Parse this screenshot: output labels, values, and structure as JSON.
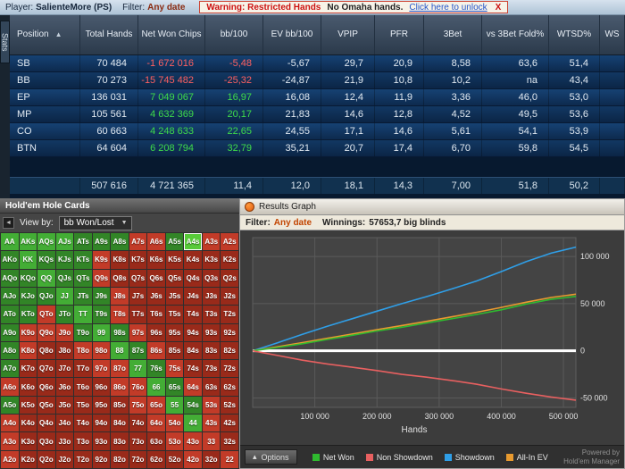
{
  "icons": {
    "sort_up": "▲",
    "chevron_down": "▼",
    "collapse_left": "◄",
    "options_up": "▴"
  },
  "topbar": {
    "player_label": "Player:",
    "player_name": "SalienteMore (PS)",
    "filter_label": "Filter:",
    "filter_value": "Any date",
    "warning": {
      "title": "Warning: Restricted Hands",
      "text": "No Omaha hands.",
      "link": "Click here to unlock",
      "close": "X"
    }
  },
  "stats_tab": "Stats",
  "table": {
    "sort_indicator": "▲",
    "columns": [
      "Position",
      "Total Hands",
      "Net Won Chips",
      "bb/100",
      "EV bb/100",
      "VPIP",
      "PFR",
      "3Bet",
      "vs 3Bet Fold%",
      "WTSD%",
      "WS"
    ],
    "rows": [
      [
        "SB",
        "70 484",
        "-1 672 016",
        "-5,48",
        "-5,67",
        "29,7",
        "20,9",
        "8,58",
        "63,6",
        "51,4",
        ""
      ],
      [
        "BB",
        "70 273",
        "-15 745 482",
        "-25,32",
        "-24,87",
        "21,9",
        "10,8",
        "10,2",
        "na",
        "43,4",
        ""
      ],
      [
        "EP",
        "136 031",
        "7 049 067",
        "16,97",
        "16,08",
        "12,4",
        "11,9",
        "3,36",
        "46,0",
        "53,0",
        ""
      ],
      [
        "MP",
        "105 561",
        "4 632 369",
        "20,17",
        "21,83",
        "14,6",
        "12,8",
        "4,52",
        "49,5",
        "53,6",
        ""
      ],
      [
        "CO",
        "60 663",
        "4 248 633",
        "22,65",
        "24,55",
        "17,1",
        "14,6",
        "5,61",
        "54,1",
        "53,9",
        ""
      ],
      [
        "BTN",
        "64 604",
        "6 208 794",
        "32,79",
        "35,21",
        "20,7",
        "17,4",
        "6,70",
        "59,8",
        "54,5",
        ""
      ]
    ],
    "summary": [
      "",
      "507 616",
      "4 721 365",
      "11,4",
      "12,0",
      "18,1",
      "14,3",
      "7,00",
      "51,8",
      "50,2",
      ""
    ]
  },
  "holecards": {
    "title": "Hold'em Hole Cards",
    "viewby_label": "View by:",
    "viewby_value": "bb Won/Lost",
    "grid": [
      [
        "AA|G",
        "AKs|G",
        "AQs|G",
        "AJs|G",
        "ATs|g",
        "A9s|g",
        "A8s|g",
        "A7s|R",
        "A6s|R",
        "A5s|g",
        "A4s|S",
        "A3s|R",
        "A2s|R"
      ],
      [
        "AKo|g",
        "KK|G",
        "KQs|g",
        "KJs|g",
        "KTs|g",
        "K9s|R",
        "K8s|r",
        "K7s|r",
        "K6s|r",
        "K5s|r",
        "K4s|r",
        "K3s|r",
        "K2s|r"
      ],
      [
        "AQo|g",
        "KQo|g",
        "QQ|G",
        "QJs|g",
        "QTs|g",
        "Q9s|R",
        "Q8s|r",
        "Q7s|r",
        "Q6s|r",
        "Q5s|r",
        "Q4s|r",
        "Q3s|r",
        "Q2s|r"
      ],
      [
        "AJo|g",
        "KJo|g",
        "QJo|g",
        "JJ|G",
        "JTs|g",
        "J9s|g",
        "J8s|R",
        "J7s|r",
        "J6s|r",
        "J5s|r",
        "J4s|r",
        "J3s|r",
        "J2s|r"
      ],
      [
        "ATo|g",
        "KTo|g",
        "QTo|R",
        "JTo|g",
        "TT|G",
        "T9s|g",
        "T8s|R",
        "T7s|r",
        "T6s|r",
        "T5s|r",
        "T4s|r",
        "T3s|r",
        "T2s|r"
      ],
      [
        "A9o|g",
        "K9o|R",
        "Q9o|R",
        "J9o|R",
        "T9o|g",
        "99|G",
        "98s|g",
        "97s|R",
        "96s|r",
        "95s|r",
        "94s|r",
        "93s|r",
        "92s|r"
      ],
      [
        "A8o|g",
        "K8o|R",
        "Q8o|r",
        "J8o|r",
        "T8o|R",
        "98o|R",
        "88|G",
        "87s|g",
        "86s|R",
        "85s|r",
        "84s|r",
        "83s|r",
        "82s|r"
      ],
      [
        "A7o|g",
        "K7o|r",
        "Q7o|r",
        "J7o|r",
        "T7o|r",
        "97o|R",
        "87o|R",
        "77|G",
        "76s|g",
        "75s|R",
        "74s|r",
        "73s|r",
        "72s|r"
      ],
      [
        "A6o|R",
        "K6o|r",
        "Q6o|r",
        "J6o|r",
        "T6o|r",
        "96o|r",
        "86o|R",
        "76o|R",
        "66|G",
        "65s|g",
        "64s|R",
        "63s|r",
        "62s|r"
      ],
      [
        "A5o|g",
        "K5o|r",
        "Q5o|r",
        "J5o|r",
        "T5o|r",
        "95o|r",
        "85o|r",
        "75o|R",
        "65o|R",
        "55|G",
        "54s|g",
        "53s|R",
        "52s|r"
      ],
      [
        "A4o|R",
        "K4o|r",
        "Q4o|r",
        "J4o|r",
        "T4o|r",
        "94o|r",
        "84o|r",
        "74o|r",
        "64o|R",
        "54o|R",
        "44|G",
        "43s|R",
        "42s|r"
      ],
      [
        "A3o|R",
        "K3o|r",
        "Q3o|r",
        "J3o|r",
        "T3o|r",
        "93o|r",
        "83o|r",
        "73o|r",
        "63o|r",
        "53o|R",
        "43o|R",
        "33|R",
        "32s|r"
      ],
      [
        "A2o|R",
        "K2o|r",
        "Q2o|r",
        "J2o|r",
        "T2o|r",
        "92o|r",
        "82o|r",
        "72o|r",
        "62o|r",
        "52o|r",
        "42o|R",
        "32o|r",
        "22|R"
      ]
    ]
  },
  "results": {
    "title": "Results Graph",
    "filter_label": "Filter:",
    "filter_value": "Any date",
    "winnings_label": "Winnings:",
    "winnings_value": "57653,7 big blinds",
    "options_label": "Options",
    "powered_by_line1": "Powered by",
    "powered_by_line2": "Hold'em Manager",
    "legend": [
      {
        "label": "Net Won",
        "color": "#2fba2f"
      },
      {
        "label": "Non Showdown",
        "color": "#e86060"
      },
      {
        "label": "Showdown",
        "color": "#2f9fe8"
      },
      {
        "label": "All-In EV",
        "color": "#e89a2f"
      }
    ]
  },
  "chart_data": {
    "type": "line",
    "title": "Results Graph",
    "xlabel": "Hands",
    "ylabel": "",
    "xlim": [
      0,
      520000
    ],
    "ylim": [
      -60000,
      120000
    ],
    "grid": true,
    "legend_position": "bottom",
    "x_ticks": [
      100000,
      200000,
      300000,
      400000,
      500000
    ],
    "x_tick_labels": [
      "100 000",
      "200 000",
      "300 000",
      "400 000",
      "500 000"
    ],
    "y_ticks": [
      -50000,
      0,
      50000,
      100000
    ],
    "y_tick_labels": [
      "-50 000",
      "0",
      "50 000",
      "100 000"
    ],
    "series": [
      {
        "name": "Showdown",
        "color": "#2f9fe8",
        "x": [
          0,
          40000,
          80000,
          120000,
          160000,
          200000,
          240000,
          280000,
          320000,
          360000,
          400000,
          440000,
          480000,
          520000
        ],
        "y": [
          0,
          8500,
          17500,
          26000,
          34000,
          42000,
          50000,
          57500,
          65500,
          74000,
          84000,
          94500,
          103500,
          110000
        ]
      },
      {
        "name": "All-In EV",
        "color": "#e89a2f",
        "x": [
          0,
          40000,
          80000,
          120000,
          160000,
          200000,
          240000,
          280000,
          320000,
          360000,
          400000,
          440000,
          480000,
          520000
        ],
        "y": [
          0,
          4200,
          8600,
          13200,
          17800,
          22400,
          26800,
          31200,
          36000,
          40800,
          46000,
          51500,
          56500,
          60000
        ]
      },
      {
        "name": "Net Won",
        "color": "#2fba2f",
        "x": [
          0,
          40000,
          80000,
          120000,
          160000,
          200000,
          240000,
          280000,
          320000,
          360000,
          400000,
          440000,
          480000,
          520000
        ],
        "y": [
          0,
          3500,
          7500,
          12000,
          16500,
          21000,
          25000,
          29500,
          34000,
          38500,
          43500,
          49500,
          54500,
          57654
        ]
      },
      {
        "name": "Non Showdown",
        "color": "#e86060",
        "x": [
          0,
          40000,
          80000,
          120000,
          160000,
          200000,
          240000,
          280000,
          320000,
          360000,
          400000,
          440000,
          480000,
          520000
        ],
        "y": [
          0,
          -5000,
          -10000,
          -14000,
          -17500,
          -21000,
          -25000,
          -28000,
          -31500,
          -35500,
          -40500,
          -45000,
          -49000,
          -52300
        ]
      }
    ]
  }
}
